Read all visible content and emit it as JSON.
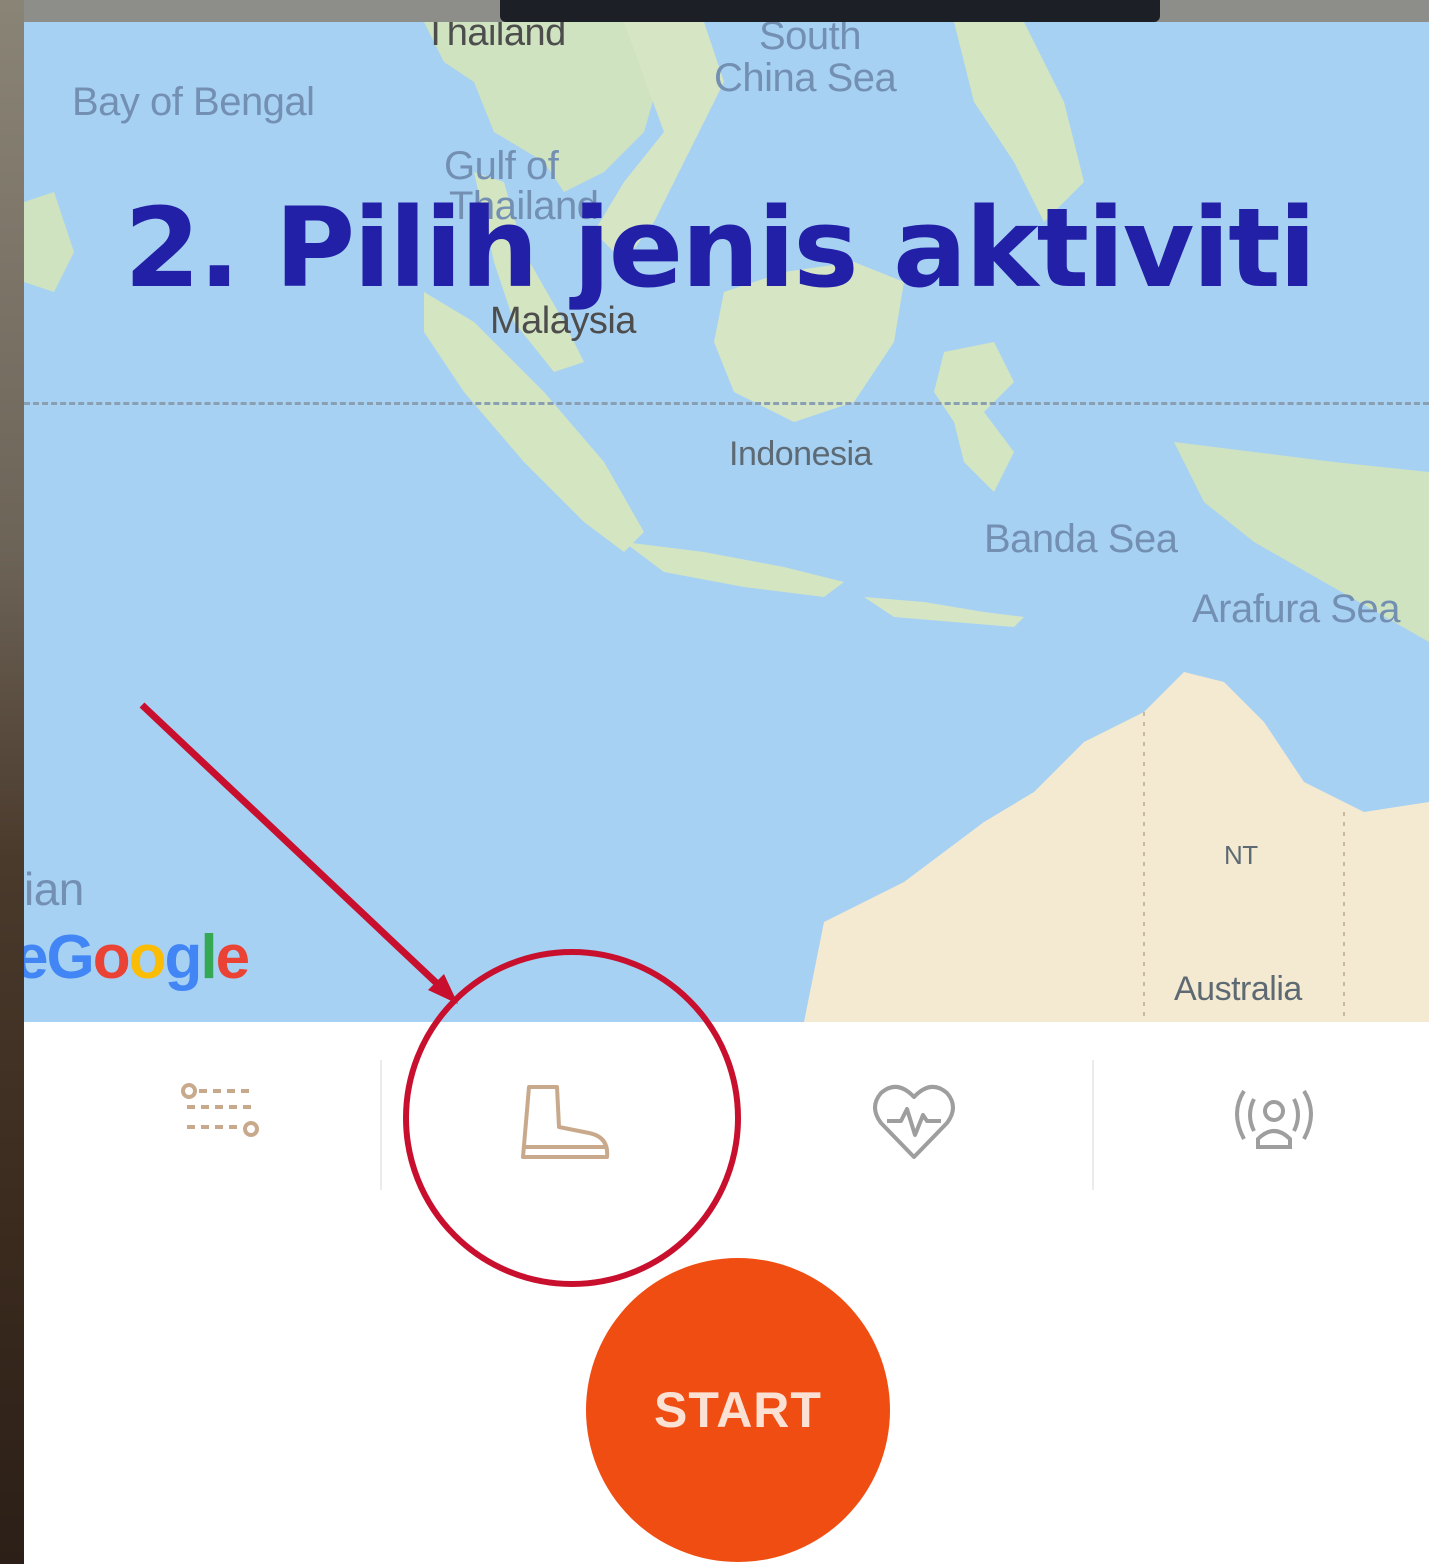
{
  "headline": "2. Pilih jenis aktiviti",
  "map": {
    "labels": {
      "thailand": "Thailand",
      "south_china_sea_1": "South",
      "south_china_sea_2": "China Sea",
      "bay_of_bengal": "Bay of Bengal",
      "gulf_of_1": "Gulf of",
      "gulf_of_2": "Thailand",
      "malaysia": "Malaysia",
      "indonesia": "Indonesia",
      "banda_sea": "Banda Sea",
      "arafura_sea": "Arafura Sea",
      "nt": "NT",
      "australia": "Australia",
      "indian_partial": "ian"
    },
    "attribution": [
      "G",
      "o",
      "o",
      "g",
      "l",
      "e"
    ],
    "attribution_prefix": "e"
  },
  "activity_tabs": [
    {
      "icon": "route-icon"
    },
    {
      "icon": "hiking-boot-icon",
      "selected": true
    },
    {
      "icon": "heart-rate-icon"
    },
    {
      "icon": "beacon-icon"
    }
  ],
  "start_label": "START",
  "colors": {
    "accent": "#f04d12",
    "headline": "#2320a8",
    "annotation": "#c8102e",
    "icon": "#c9a98c"
  }
}
